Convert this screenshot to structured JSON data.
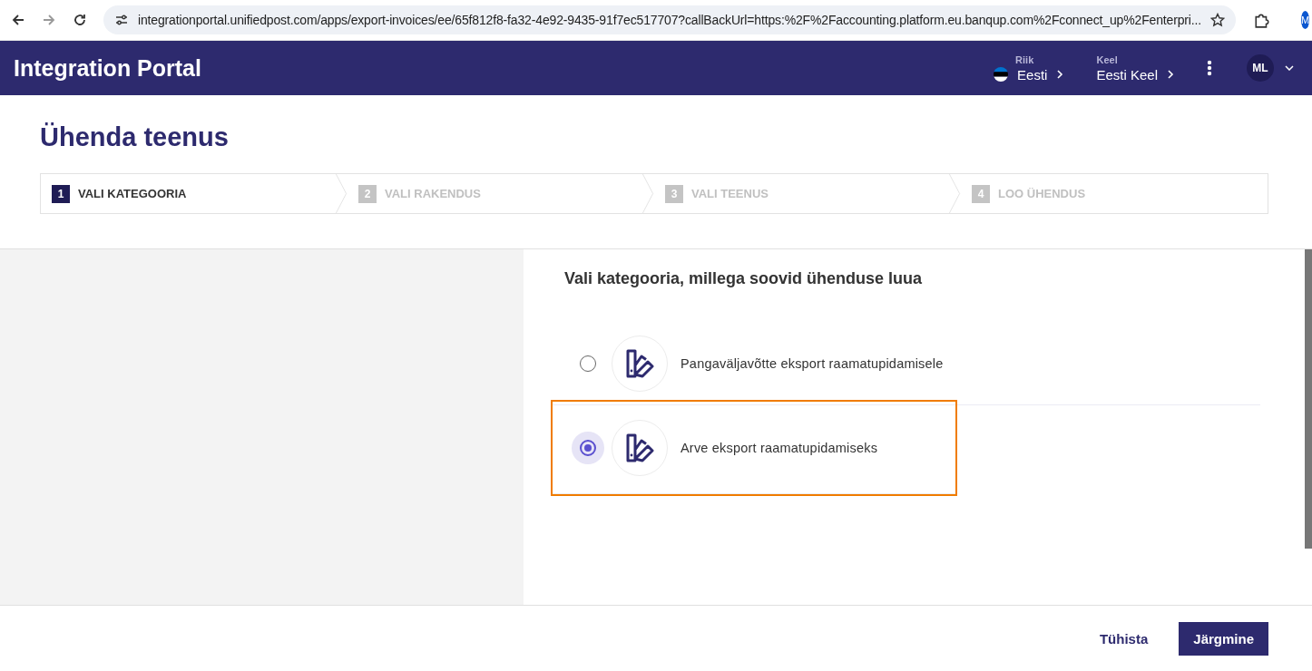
{
  "browser": {
    "url": "integrationportal.unifiedpost.com/apps/export-invoices/ee/65f812f8-fa32-4e92-9435-91f7ec517707?callBackUrl=https:%2F%2Faccounting.platform.eu.banqup.com%2Fconnect_up%2Fenterpri...",
    "profile": "M"
  },
  "header": {
    "title": "Integration Portal",
    "country": {
      "label": "Riik",
      "value": "Eesti"
    },
    "language": {
      "label": "Keel",
      "value": "Eesti Keel"
    },
    "avatar": "ML"
  },
  "page_title": "Ühenda teenus",
  "steps": [
    {
      "number": "1",
      "label": "VALI KATEGOORIA",
      "selected": true
    },
    {
      "number": "2",
      "label": "VALI RAKENDUS",
      "selected": false
    },
    {
      "number": "3",
      "label": "VALI TEENUS",
      "selected": false
    },
    {
      "number": "4",
      "label": "LOO ÜHENDUS",
      "selected": false
    }
  ],
  "question": "Vali kategooria, millega soovid ühenduse luua",
  "options": [
    {
      "label": "Pangaväljavõtte eksport raamatupidamisele",
      "selected": false,
      "highlighted": false
    },
    {
      "label": "Arve eksport raamatupidamiseks",
      "selected": true,
      "highlighted": true
    }
  ],
  "buttons": {
    "cancel": "Tühista",
    "next": "Järgmine"
  }
}
